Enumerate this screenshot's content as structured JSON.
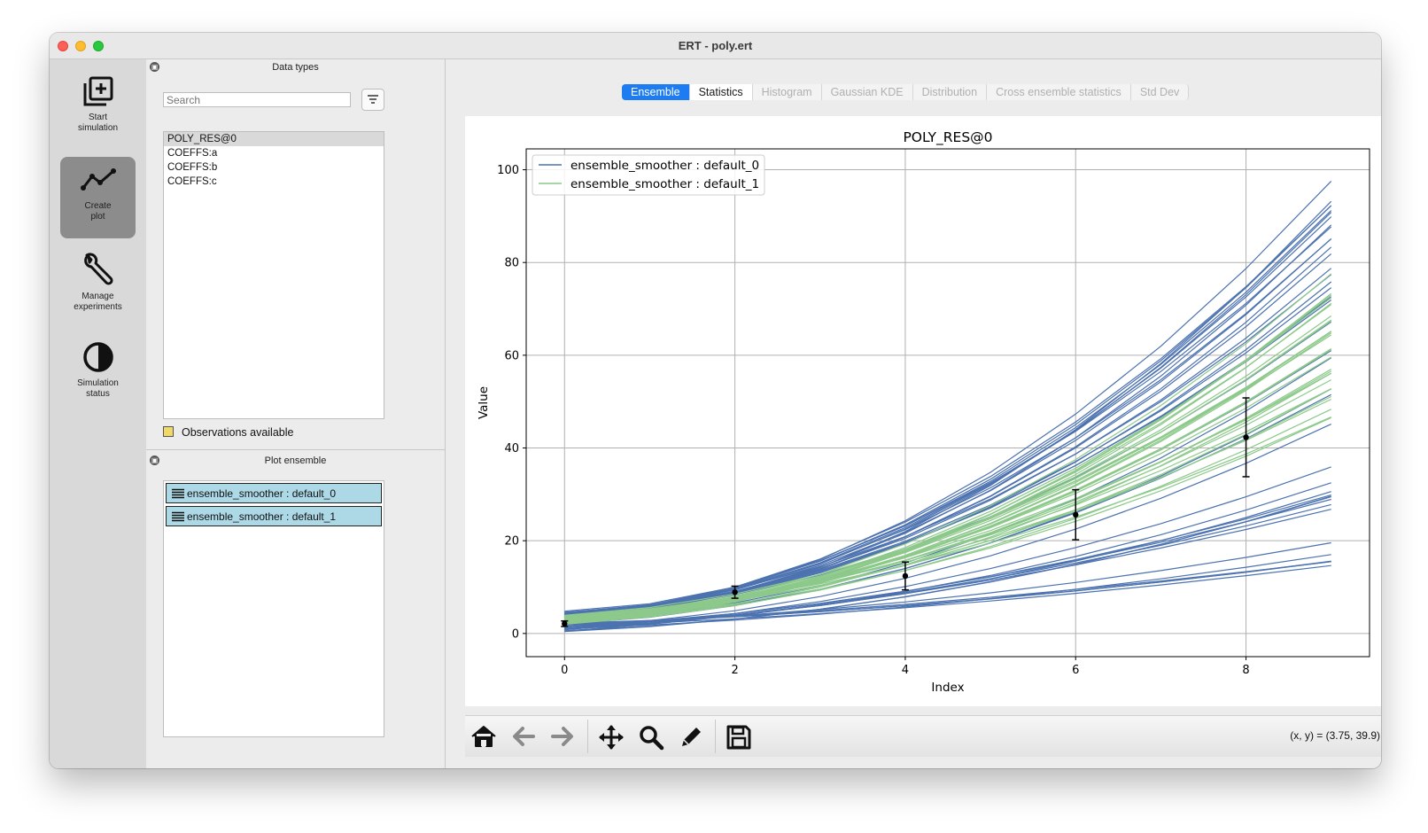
{
  "window": {
    "title": "ERT - poly.ert"
  },
  "sidebar": {
    "items": [
      {
        "label_line1": "Start",
        "label_line2": "simulation",
        "icon": "add-box-icon"
      },
      {
        "label_line1": "Create",
        "label_line2": "plot",
        "icon": "line-chart-icon",
        "active": true
      },
      {
        "label_line1": "Manage",
        "label_line2": "experiments",
        "icon": "wrench-icon"
      },
      {
        "label_line1": "Simulation",
        "label_line2": "status",
        "icon": "half-circle-icon"
      }
    ]
  },
  "data_types": {
    "title": "Data types",
    "search_placeholder": "Search",
    "items": [
      "POLY_RES@0",
      "COEFFS:a",
      "COEFFS:b",
      "COEFFS:c"
    ],
    "selected": "POLY_RES@0",
    "observations_label": "Observations available"
  },
  "plot_ensemble": {
    "title": "Plot ensemble",
    "items": [
      "ensemble_smoother : default_0",
      "ensemble_smoother : default_1"
    ]
  },
  "tabs": [
    "Ensemble",
    "Statistics",
    "Histogram",
    "Gaussian KDE",
    "Distribution",
    "Cross ensemble statistics",
    "Std Dev"
  ],
  "active_tab": "Ensemble",
  "toolbar": {
    "coord_readout": "(x, y) = (3.75, 39.9)"
  },
  "colors": {
    "series0": "#4c72b0",
    "series1": "#8cc98a",
    "tab_active": "#1d7cf2",
    "selection": "#add8e6"
  },
  "chart_data": {
    "type": "line",
    "title": "POLY_RES@0",
    "xlabel": "Index",
    "ylabel": "Value",
    "xlim": [
      -0.45,
      9.45
    ],
    "ylim": [
      -5,
      104.5
    ],
    "xticks": [
      "0",
      "2",
      "4",
      "6",
      "8"
    ],
    "yticks": [
      "0",
      "20",
      "40",
      "60",
      "80",
      "100"
    ],
    "grid": true,
    "legend_position": "top-left",
    "x": [
      0,
      1,
      2,
      3,
      4,
      5,
      6,
      7,
      8,
      9
    ],
    "series": [
      {
        "name": "ensemble_smoother : default_0",
        "color": "#4c72b0",
        "params": [
          [
            0.7,
            0.7,
            4.2
          ],
          [
            0.8,
            0.9,
            4.5
          ],
          [
            1.0,
            0.6,
            4.8
          ],
          [
            1.05,
            1.0,
            3.5
          ],
          [
            0.9,
            1.2,
            4.0
          ],
          [
            0.75,
            0.9,
            3.8
          ],
          [
            1.02,
            0.4,
            4.6
          ],
          [
            0.97,
            0.8,
            4.1
          ],
          [
            0.88,
            1.1,
            3.9
          ],
          [
            1.0,
            0.3,
            4.4
          ],
          [
            0.92,
            0.7,
            4.3
          ],
          [
            0.85,
            0.6,
            4.5
          ],
          [
            0.95,
            1.3,
            3.6
          ],
          [
            0.78,
            0.8,
            4.2
          ],
          [
            0.99,
            0.9,
            4.0
          ],
          [
            0.72,
            1.1,
            3.7
          ],
          [
            0.83,
            0.5,
            4.1
          ],
          [
            0.93,
            0.4,
            4.4
          ],
          [
            0.87,
            0.9,
            3.3
          ],
          [
            1.08,
            0.2,
            3.9
          ],
          [
            0.3,
            0.8,
            1.0
          ],
          [
            0.25,
            0.9,
            1.5
          ],
          [
            0.28,
            0.7,
            0.6
          ],
          [
            0.32,
            1.0,
            1.0
          ],
          [
            0.2,
            1.2,
            0.8
          ],
          [
            0.22,
            1.1,
            1.2
          ],
          [
            0.27,
            0.8,
            0.4
          ],
          [
            0.3,
            0.5,
            1.8
          ],
          [
            0.18,
            1.3,
            0.5
          ],
          [
            0.15,
            0.6,
            2.0
          ],
          [
            0.11,
            0.5,
            2.2
          ],
          [
            0.1,
            0.6,
            2.0
          ],
          [
            0.08,
            0.8,
            1.8
          ],
          [
            0.12,
            0.7,
            1.0
          ],
          [
            0.09,
            0.65,
            1.5
          ],
          [
            0.6,
            1.1,
            2.5
          ],
          [
            0.65,
            0.4,
            3.2
          ],
          [
            0.55,
            0.6,
            2.8
          ],
          [
            0.45,
            0.8,
            1.5
          ],
          [
            0.5,
            1.0,
            2.0
          ]
        ]
      },
      {
        "name": "ensemble_smoother : default_1",
        "color": "#8cc98a",
        "params": [
          [
            0.6,
            1.2,
            2.0
          ],
          [
            0.65,
            1.0,
            3.5
          ],
          [
            0.7,
            0.9,
            2.8
          ],
          [
            0.75,
            0.8,
            3.0
          ],
          [
            0.8,
            0.7,
            2.2
          ],
          [
            0.85,
            0.6,
            3.3
          ],
          [
            0.55,
            1.0,
            3.0
          ],
          [
            0.5,
            1.3,
            2.5
          ],
          [
            0.45,
            1.1,
            2.0
          ],
          [
            0.6,
            0.8,
            3.8
          ],
          [
            0.7,
            0.5,
            3.6
          ],
          [
            0.68,
            1.1,
            2.4
          ],
          [
            0.62,
            0.9,
            2.9
          ],
          [
            0.58,
            0.7,
            3.7
          ],
          [
            0.52,
            1.2,
            3.2
          ],
          [
            0.47,
            1.3,
            3.0
          ],
          [
            0.78,
            0.6,
            2.6
          ],
          [
            0.72,
            0.75,
            3.4
          ],
          [
            0.4,
            1.2,
            3.5
          ],
          [
            0.43,
            1.0,
            2.7
          ],
          [
            0.66,
            0.95,
            3.1
          ],
          [
            0.57,
            0.85,
            2.3
          ],
          [
            0.63,
            1.05,
            3.9
          ],
          [
            0.49,
            0.9,
            3.3
          ],
          [
            0.74,
            1.15,
            2.1
          ],
          [
            0.69,
            0.7,
            3.0
          ],
          [
            0.54,
            0.6,
            3.6
          ],
          [
            0.81,
            0.5,
            2.9
          ],
          [
            0.46,
            1.05,
            3.8
          ],
          [
            0.59,
            1.25,
            2.2
          ]
        ]
      }
    ],
    "observations": [
      {
        "x": 0,
        "y": 2.1,
        "err": 0.6
      },
      {
        "x": 2,
        "y": 8.9,
        "err": 1.3
      },
      {
        "x": 4,
        "y": 12.4,
        "err": 3.0
      },
      {
        "x": 6,
        "y": 25.6,
        "err": 5.4
      },
      {
        "x": 8,
        "y": 42.3,
        "err": 8.5
      }
    ]
  }
}
